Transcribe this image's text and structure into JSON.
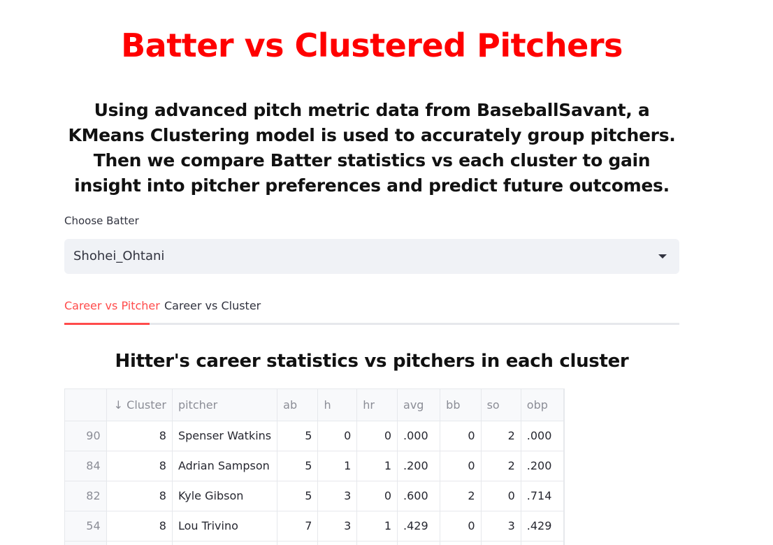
{
  "title": "Batter vs Clustered Pitchers",
  "description": "Using advanced pitch metric data from BaseballSavant, a KMeans Clustering model is used to accurately group pitchers. Then we compare Batter statistics vs each cluster to gain insight into pitcher preferences and predict future outcomes.",
  "selector": {
    "label": "Choose Batter",
    "value": "Shohei_Ohtani"
  },
  "tabs": [
    {
      "label": "Career vs Pitcher",
      "active": true
    },
    {
      "label": "Career vs Cluster",
      "active": false
    }
  ],
  "section_heading": "Hitter's career statistics vs pitchers in each cluster",
  "table": {
    "columns": [
      "",
      "↓ Cluster",
      "pitcher",
      "ab",
      "h",
      "hr",
      "avg",
      "bb",
      "so",
      "obp"
    ],
    "rows": [
      [
        "90",
        "8",
        "Spenser Watkins",
        "5",
        "0",
        "0",
        ".000",
        "0",
        "2",
        ".000"
      ],
      [
        "84",
        "8",
        "Adrian Sampson",
        "5",
        "1",
        "1",
        ".200",
        "0",
        "2",
        ".200"
      ],
      [
        "82",
        "8",
        "Kyle Gibson",
        "5",
        "3",
        "0",
        ".600",
        "2",
        "0",
        ".714"
      ],
      [
        "54",
        "8",
        "Lou Trivino",
        "7",
        "3",
        "1",
        ".429",
        "0",
        "3",
        ".429"
      ],
      [
        "",
        "",
        "",
        "",
        "",
        "",
        "",
        "",
        "",
        ""
      ]
    ]
  },
  "colors": {
    "title": "#ff0000",
    "accent": "#ff4b4b",
    "select_bg": "#f0f2f6"
  },
  "icons": {
    "select_caret": "caret-down-icon",
    "sort": "arrow-down-icon"
  }
}
